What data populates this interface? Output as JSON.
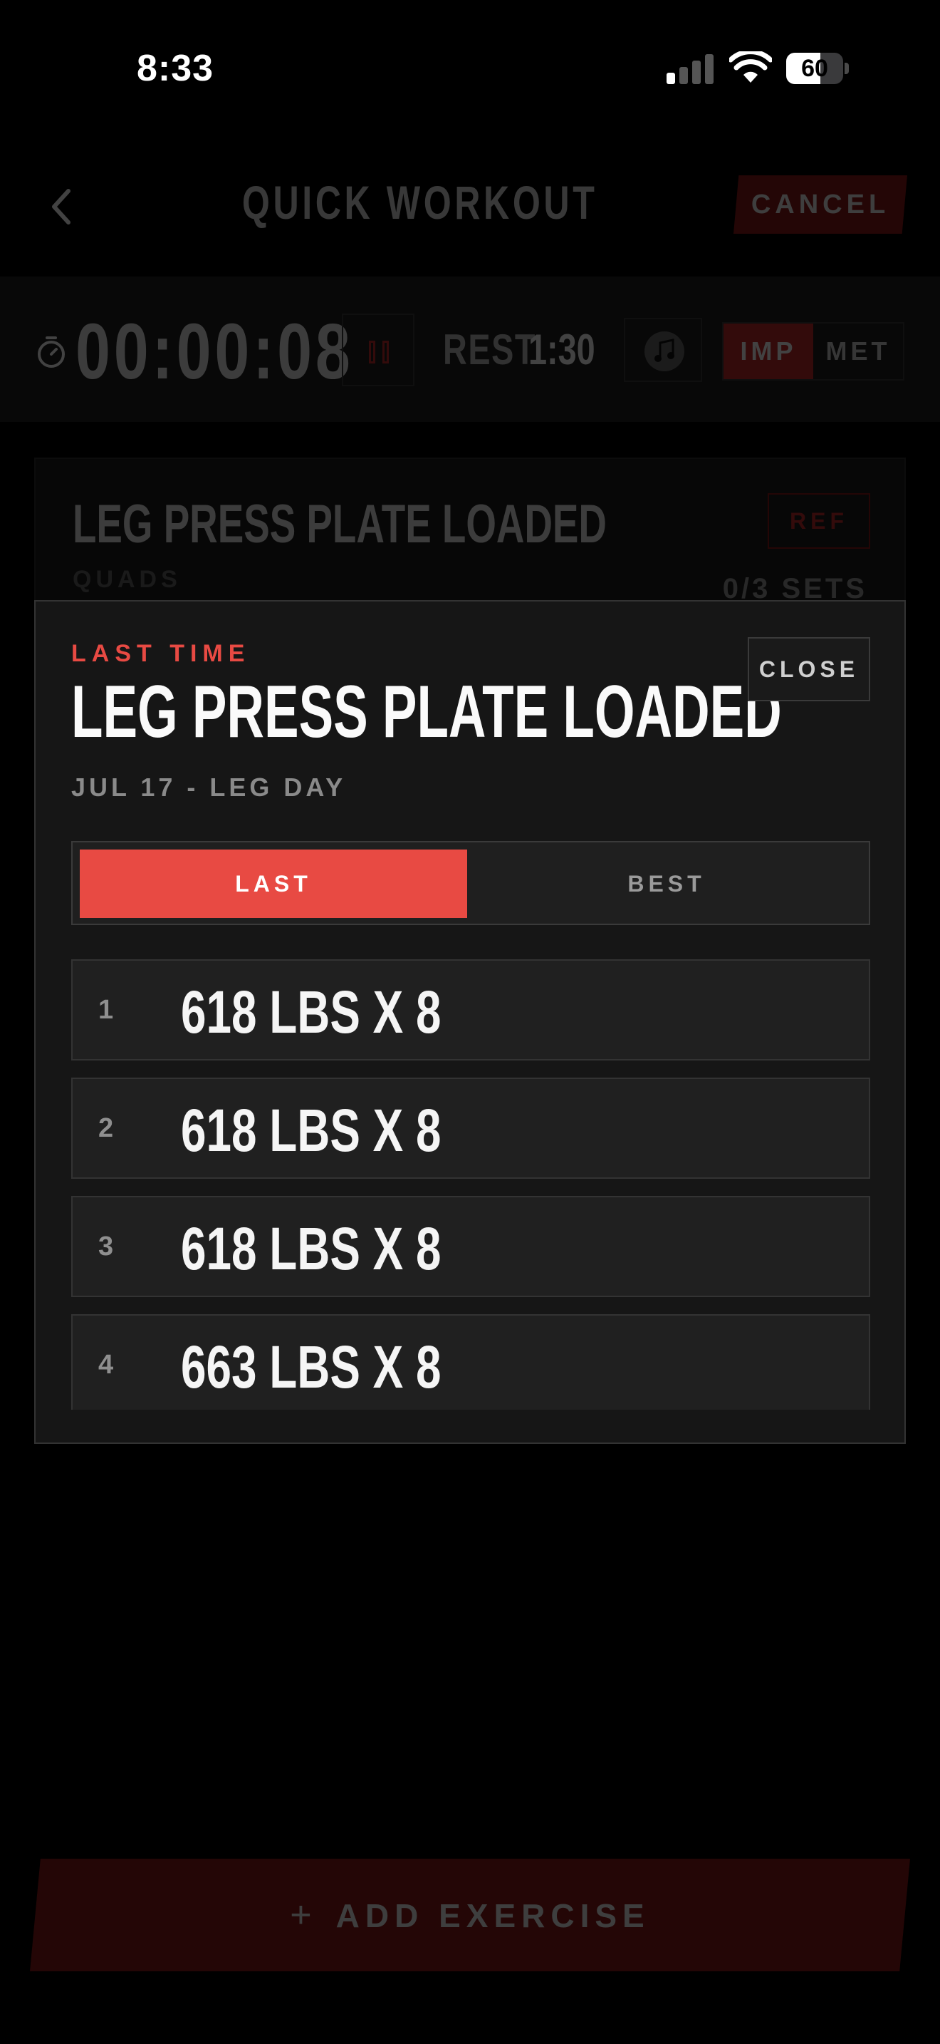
{
  "status_bar": {
    "time": "8:33",
    "battery_level": "60",
    "battery_fraction": 0.6,
    "signal_bars_active": 1,
    "signal_bars_total": 4
  },
  "header": {
    "title": "QUICK WORKOUT",
    "cancel_label": "CANCEL",
    "back_icon": "chevron-left-icon"
  },
  "timer_bar": {
    "elapsed": "00:00:08",
    "rest_label": "REST",
    "rest_value": "1:30",
    "units": {
      "imperial": "IMP",
      "metric": "MET",
      "selected": "IMP"
    },
    "icons": [
      "stopwatch-icon",
      "pause-icon",
      "music-note-icon"
    ]
  },
  "exercise_card": {
    "name": "LEG PRESS PLATE LOADED",
    "muscle": "QUADS",
    "ref_label": "REF",
    "sets_progress": "0/3 SETS"
  },
  "modal": {
    "kicker": "LAST TIME",
    "title": "LEG PRESS PLATE LOADED",
    "date_line": "JUL 17 - LEG DAY",
    "close_label": "CLOSE",
    "tabs": [
      {
        "label": "LAST",
        "active": true
      },
      {
        "label": "BEST",
        "active": false
      }
    ],
    "sets": [
      {
        "number": "1",
        "text": "618 LBS X 8"
      },
      {
        "number": "2",
        "text": "618 LBS X 8"
      },
      {
        "number": "3",
        "text": "618 LBS X 8"
      },
      {
        "number": "4",
        "text": "663 LBS X 8"
      }
    ]
  },
  "footer": {
    "add_exercise_label": "ADD EXERCISE",
    "add_icon": "plus-icon"
  },
  "colors": {
    "accent": "#e84a43",
    "accent_dark": "#8a1a1a",
    "background": "#000000",
    "modal_bg": "#161616",
    "row_bg": "#202020"
  }
}
